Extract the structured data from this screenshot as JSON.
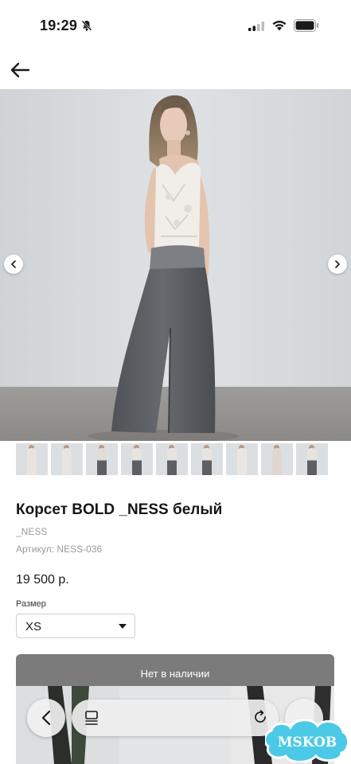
{
  "status_bar": {
    "time": "19:29"
  },
  "product": {
    "title": "Корсет BOLD _NESS белый",
    "brand": "_NESS",
    "sku_label": "Артикул:",
    "sku": "NESS-036",
    "price": "19 500 р.",
    "size_label": "Размер",
    "size_value": "XS",
    "stock_button": "Нет в наличии"
  },
  "watermark": {
    "text": "MSKOB"
  },
  "colors": {
    "stock_button": "#7b7b7b",
    "watermark_fill": "#4cc9e6"
  },
  "thumbnails": [
    {
      "top": "#e9e4e0",
      "bottom": "#e9e4e0"
    },
    {
      "top": "#e9e4e0",
      "bottom": "#e9e4e0"
    },
    {
      "top": "#e2dcd6",
      "bottom": "#5c5f64"
    },
    {
      "top": "#e9e4e0",
      "bottom": "#5c5f64"
    },
    {
      "top": "#e9e4e0",
      "bottom": "#5c5f64"
    },
    {
      "top": "#e9e4e0",
      "bottom": "#5c5f64"
    },
    {
      "top": "#eae6e2",
      "bottom": "#eae6e2"
    },
    {
      "top": "#e0d6cf",
      "bottom": "#e0d6cf"
    },
    {
      "top": "#e9e4e0",
      "bottom": "#5c5f64"
    }
  ]
}
